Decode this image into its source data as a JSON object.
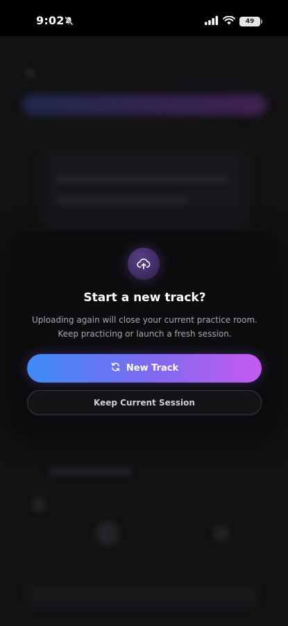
{
  "status_bar": {
    "time": "9:02",
    "battery": "49",
    "icons": [
      "bell-off-icon",
      "signal-icon",
      "wifi-icon",
      "battery-icon"
    ]
  },
  "modal": {
    "icon": "cloud-upload-icon",
    "title": "Start a new track?",
    "description_line1": "Uploading again will close your current practice room.",
    "description_line2": "Keep practicing or launch a fresh session.",
    "primary_button": {
      "icon": "refresh-icon",
      "label": "New Track"
    },
    "secondary_button": {
      "label": "Keep Current Session"
    }
  },
  "colors": {
    "accent_start": "#3f8cf7",
    "accent_end": "#c55af0",
    "modal_bg": "#0c0c0e",
    "text_muted": "#a9a6b0"
  }
}
